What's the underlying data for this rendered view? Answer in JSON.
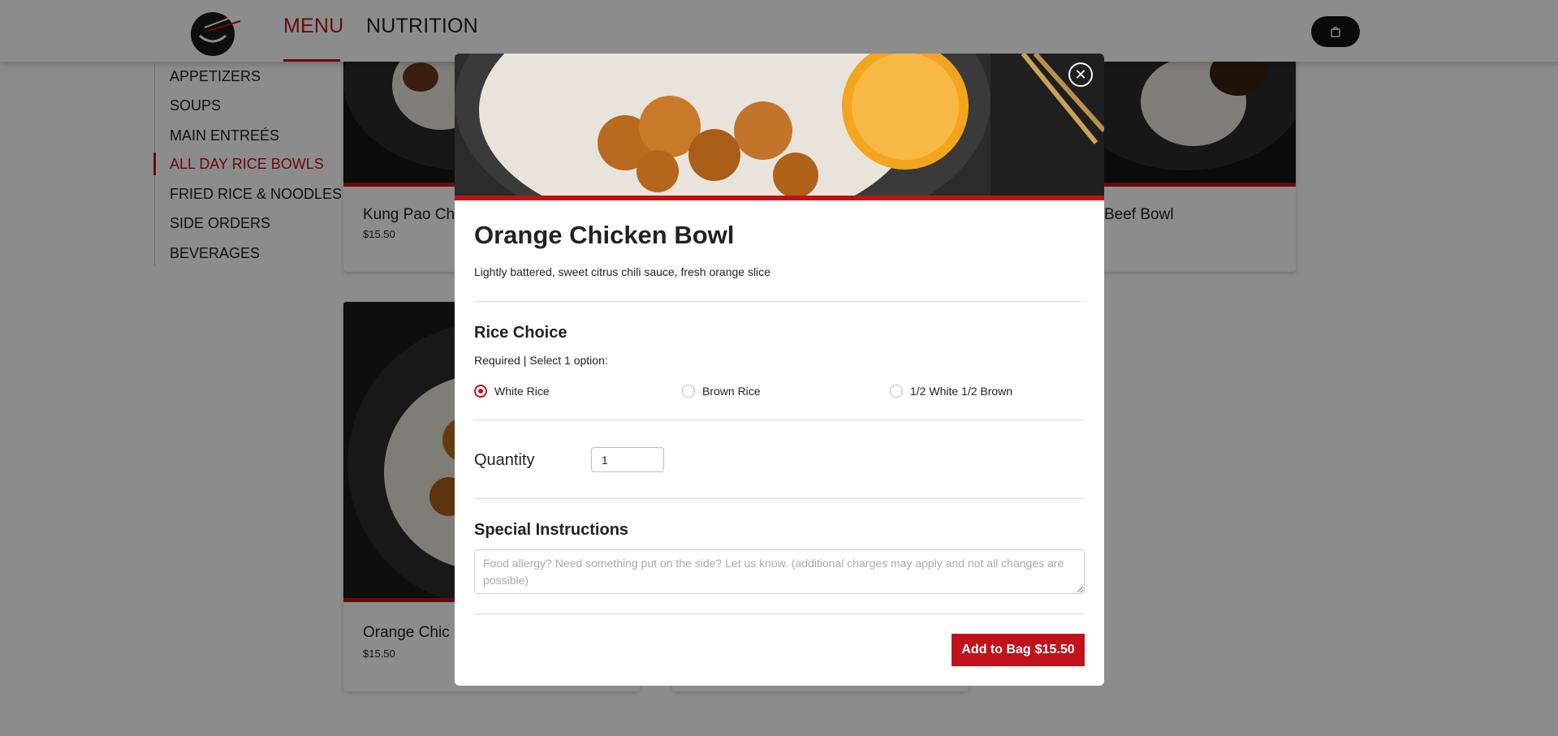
{
  "header": {
    "logo_icon": "chopsticks-bowl-logo-icon",
    "nav": [
      {
        "label": "MENU",
        "active": true
      },
      {
        "label": "NUTRITION",
        "active": false
      }
    ],
    "bag_icon": "shopping-bag-icon"
  },
  "sidebar": {
    "items": [
      {
        "label": "APPETIZERS",
        "active": false
      },
      {
        "label": "SOUPS",
        "active": false
      },
      {
        "label": "MAIN ENTREÉS",
        "active": false
      },
      {
        "label": "ALL DAY RICE BOWLS",
        "active": true
      },
      {
        "label": "FRIED RICE & NOODLES",
        "active": false
      },
      {
        "label": "SIDE ORDERS",
        "active": false
      },
      {
        "label": "BEVERAGES",
        "active": false
      }
    ]
  },
  "cards": [
    {
      "name": "Kung Pao Ch",
      "price": "$15.50"
    },
    {
      "name": "Beef Bowl",
      "price": ""
    },
    {
      "name": "Orange Chic",
      "price": "$15.50"
    }
  ],
  "modal": {
    "close_icon": "close-icon",
    "title": "Orange Chicken Bowl",
    "description": "Lightly battered, sweet citrus chili sauce, fresh orange slice",
    "rice": {
      "title": "Rice Choice",
      "requirement": "Required | Select 1 option:",
      "options": [
        {
          "label": "White Rice",
          "checked": true
        },
        {
          "label": "Brown Rice",
          "checked": false
        },
        {
          "label": "1/2 White 1/2 Brown",
          "checked": false
        }
      ]
    },
    "quantity": {
      "label": "Quantity",
      "value": "1"
    },
    "instructions": {
      "title": "Special Instructions",
      "placeholder": "Food allergy? Need something put on the side? Let us know. (additional charges may apply and not all changes are possible)"
    },
    "add_button": {
      "label": "Add to Bag",
      "price": "$15.50"
    }
  },
  "colors": {
    "accent": "#c0121b",
    "overlay": "rgba(0,0,0,0.45)",
    "dark": "#111111"
  }
}
